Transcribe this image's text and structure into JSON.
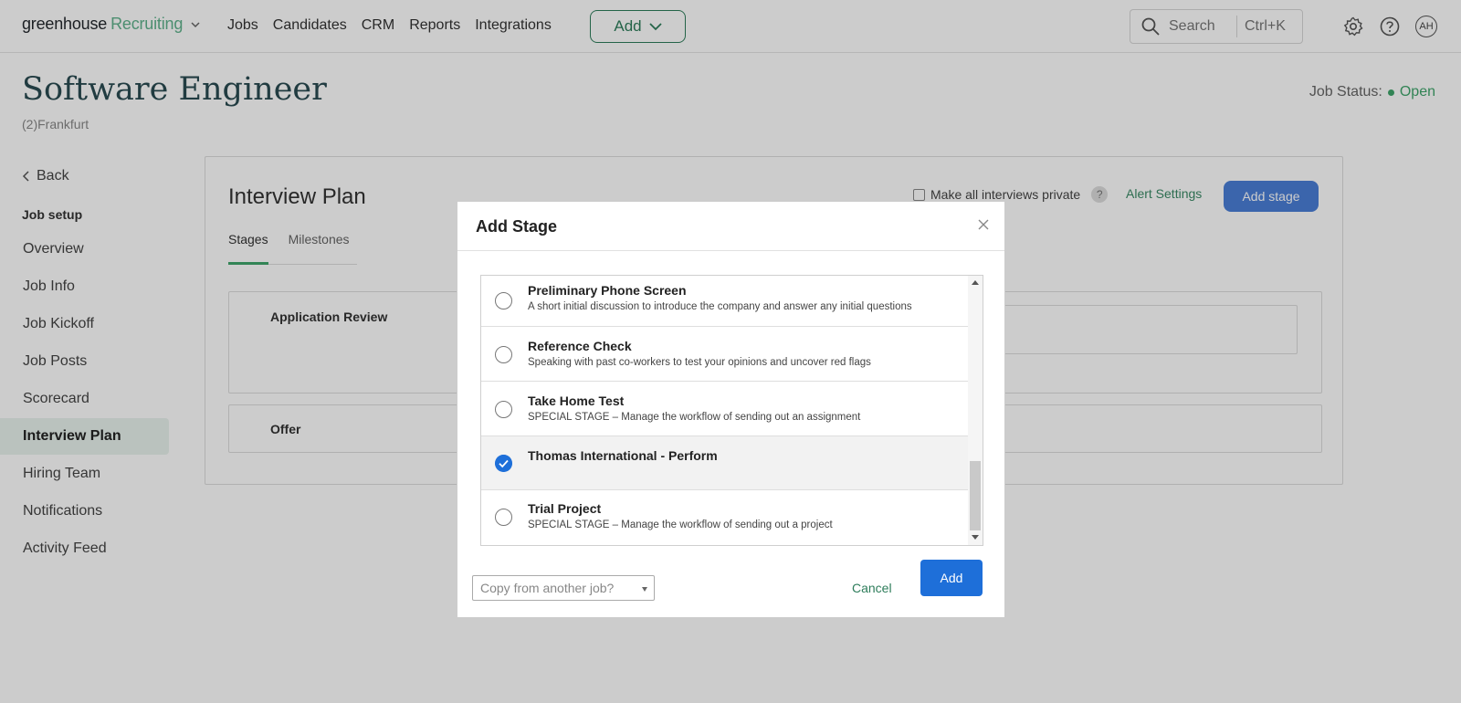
{
  "nav": {
    "logo_main": "greenhouse",
    "logo_accent": "Recruiting",
    "links": [
      "Jobs",
      "Candidates",
      "CRM",
      "Reports",
      "Integrations"
    ],
    "add_label": "Add",
    "search_placeholder": "Search",
    "search_shortcut": "Ctrl+K",
    "avatar_initials": "AH",
    "accent_color": "#5fb28c"
  },
  "header": {
    "title": "Software Engineer",
    "subtitle": "(2)Frankfurt",
    "status_label": "Job Status:",
    "status_value": "Open"
  },
  "sidebar": {
    "back_label": "Back",
    "section_label": "Job setup",
    "items": [
      {
        "label": "Overview"
      },
      {
        "label": "Job Info"
      },
      {
        "label": "Job Kickoff"
      },
      {
        "label": "Job Posts"
      },
      {
        "label": "Scorecard"
      },
      {
        "label": "Interview Plan",
        "active": true
      },
      {
        "label": "Hiring Team"
      },
      {
        "label": "Notifications"
      },
      {
        "label": "Activity Feed"
      }
    ]
  },
  "main": {
    "title": "Interview Plan",
    "private_label": "Make all interviews private",
    "help_glyph": "?",
    "alert_settings": "Alert Settings",
    "add_stage": "Add stage",
    "tabs": [
      {
        "label": "Stages",
        "active": true
      },
      {
        "label": "Milestones"
      }
    ],
    "stages": [
      "Application Review",
      "Offer"
    ]
  },
  "modal": {
    "title": "Add Stage",
    "items": [
      {
        "name": "Preliminary Phone Screen",
        "desc": "A short initial discussion to introduce the company and answer any initial questions",
        "checked": false
      },
      {
        "name": "Reference Check",
        "desc": "Speaking with past co-workers to test your opinions and uncover red flags",
        "checked": false
      },
      {
        "name": "Take Home Test",
        "desc": "SPECIAL STAGE – Manage the workflow of sending out an assignment",
        "checked": false
      },
      {
        "name": "Thomas International - Perform",
        "desc": "",
        "checked": true
      },
      {
        "name": "Trial Project",
        "desc": "SPECIAL STAGE – Manage the workflow of sending out a project",
        "checked": false
      }
    ],
    "copy_placeholder": "Copy from another job?",
    "cancel_label": "Cancel",
    "add_label": "Add",
    "selected_color": "#1e6fd9"
  }
}
